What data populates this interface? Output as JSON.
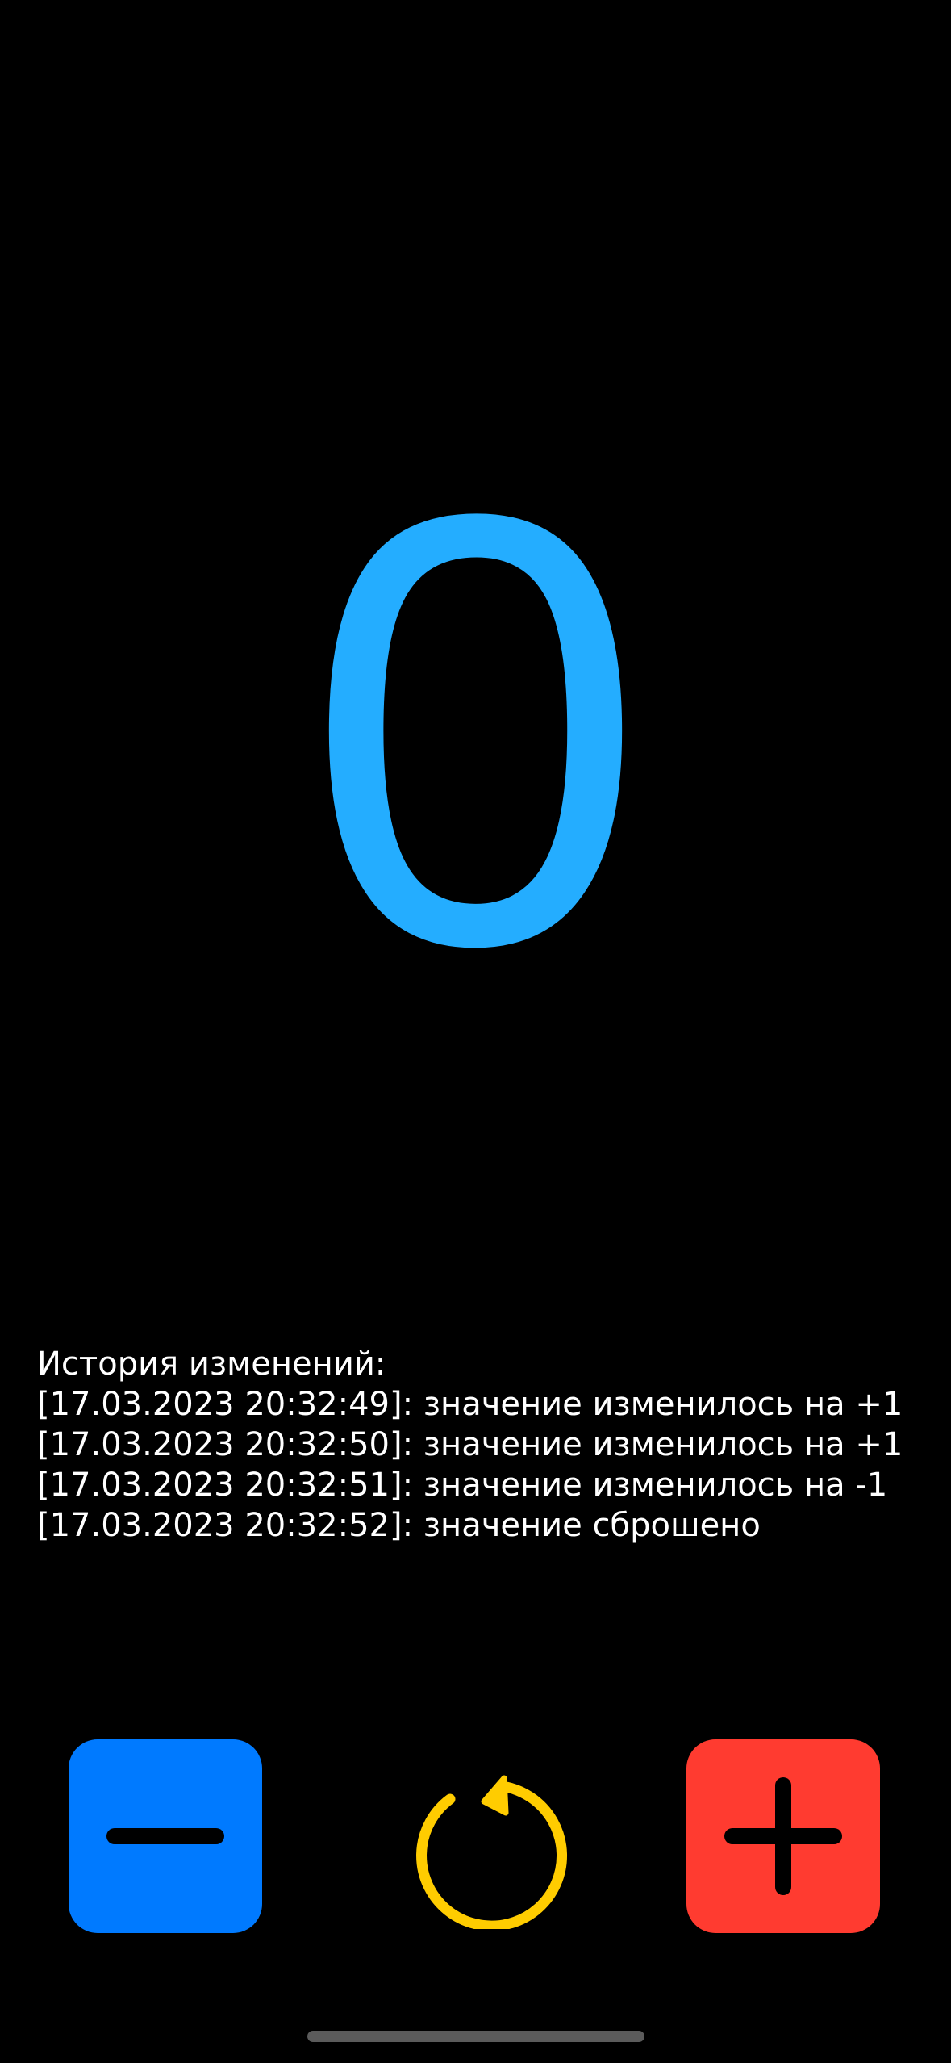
{
  "counter": {
    "value": "0"
  },
  "history": {
    "title": "История изменений:",
    "entries": [
      "[17.03.2023 20:32:49]: значение изменилось на +1",
      "[17.03.2023 20:32:50]: значение изменилось на +1",
      "[17.03.2023 20:32:51]: значение изменилось на -1",
      "[17.03.2023 20:32:52]: значение сброшено"
    ]
  },
  "controls": {
    "decrement": {
      "icon": "minus-icon",
      "color": "#007aff"
    },
    "reset": {
      "icon": "reset-arrow-icon",
      "color": "#ffcc00"
    },
    "increment": {
      "icon": "plus-icon",
      "color": "#ff3b30"
    }
  },
  "colors": {
    "background": "#000000",
    "counter_text": "#24adff",
    "history_text": "#ffffff"
  }
}
